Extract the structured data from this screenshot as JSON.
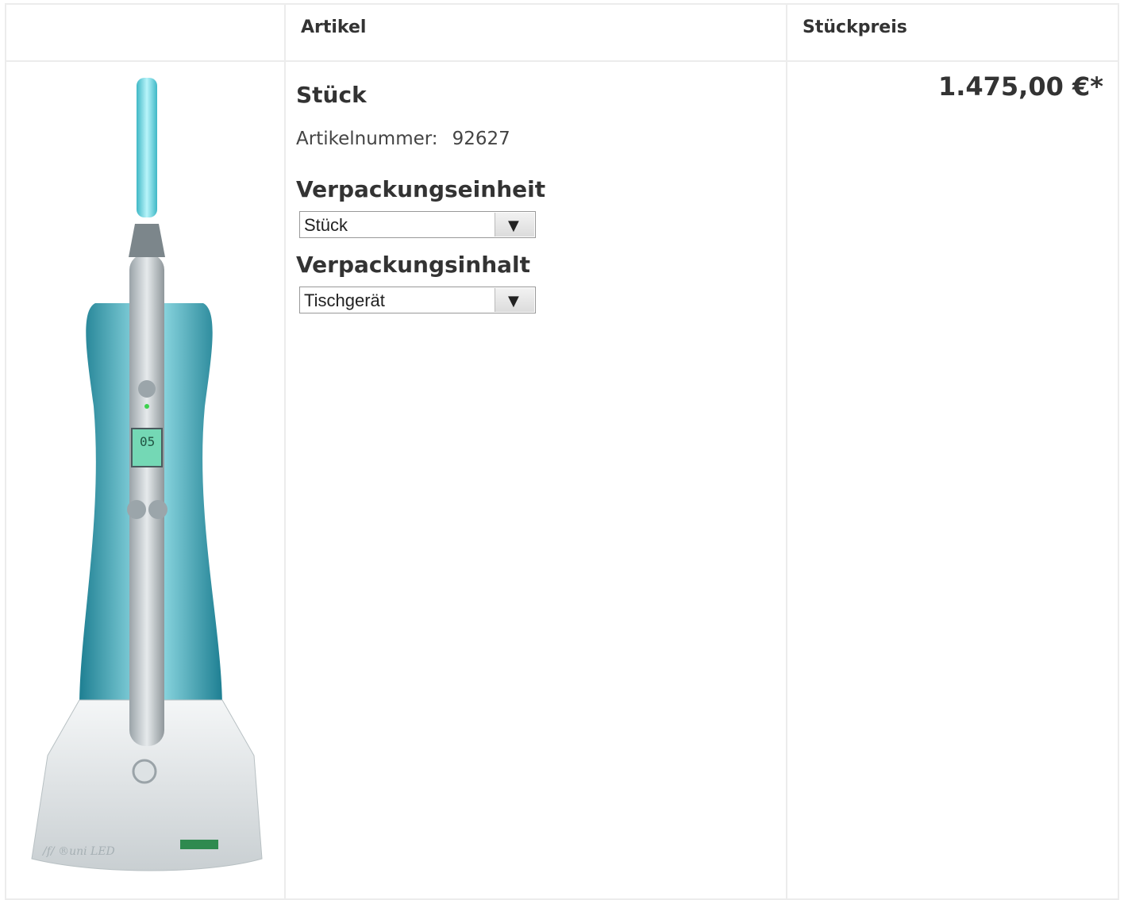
{
  "table": {
    "header": {
      "article": "Artikel",
      "unit_price": "Stückpreis"
    }
  },
  "product": {
    "name": "Stück",
    "sku_label": "Artikelnummer:",
    "sku_value": "92627",
    "packaging_unit_label": "Verpackungseinheit",
    "packaging_unit_value": "Stück",
    "packaging_content_label": "Verpackungsinhalt",
    "packaging_content_value": "Tischgerät",
    "price": "1.475,00 €*",
    "image_icon": "led-curing-light-image"
  },
  "colors": {
    "border": "#ececec",
    "text": "#333333",
    "accent": "#5fd0d8"
  }
}
